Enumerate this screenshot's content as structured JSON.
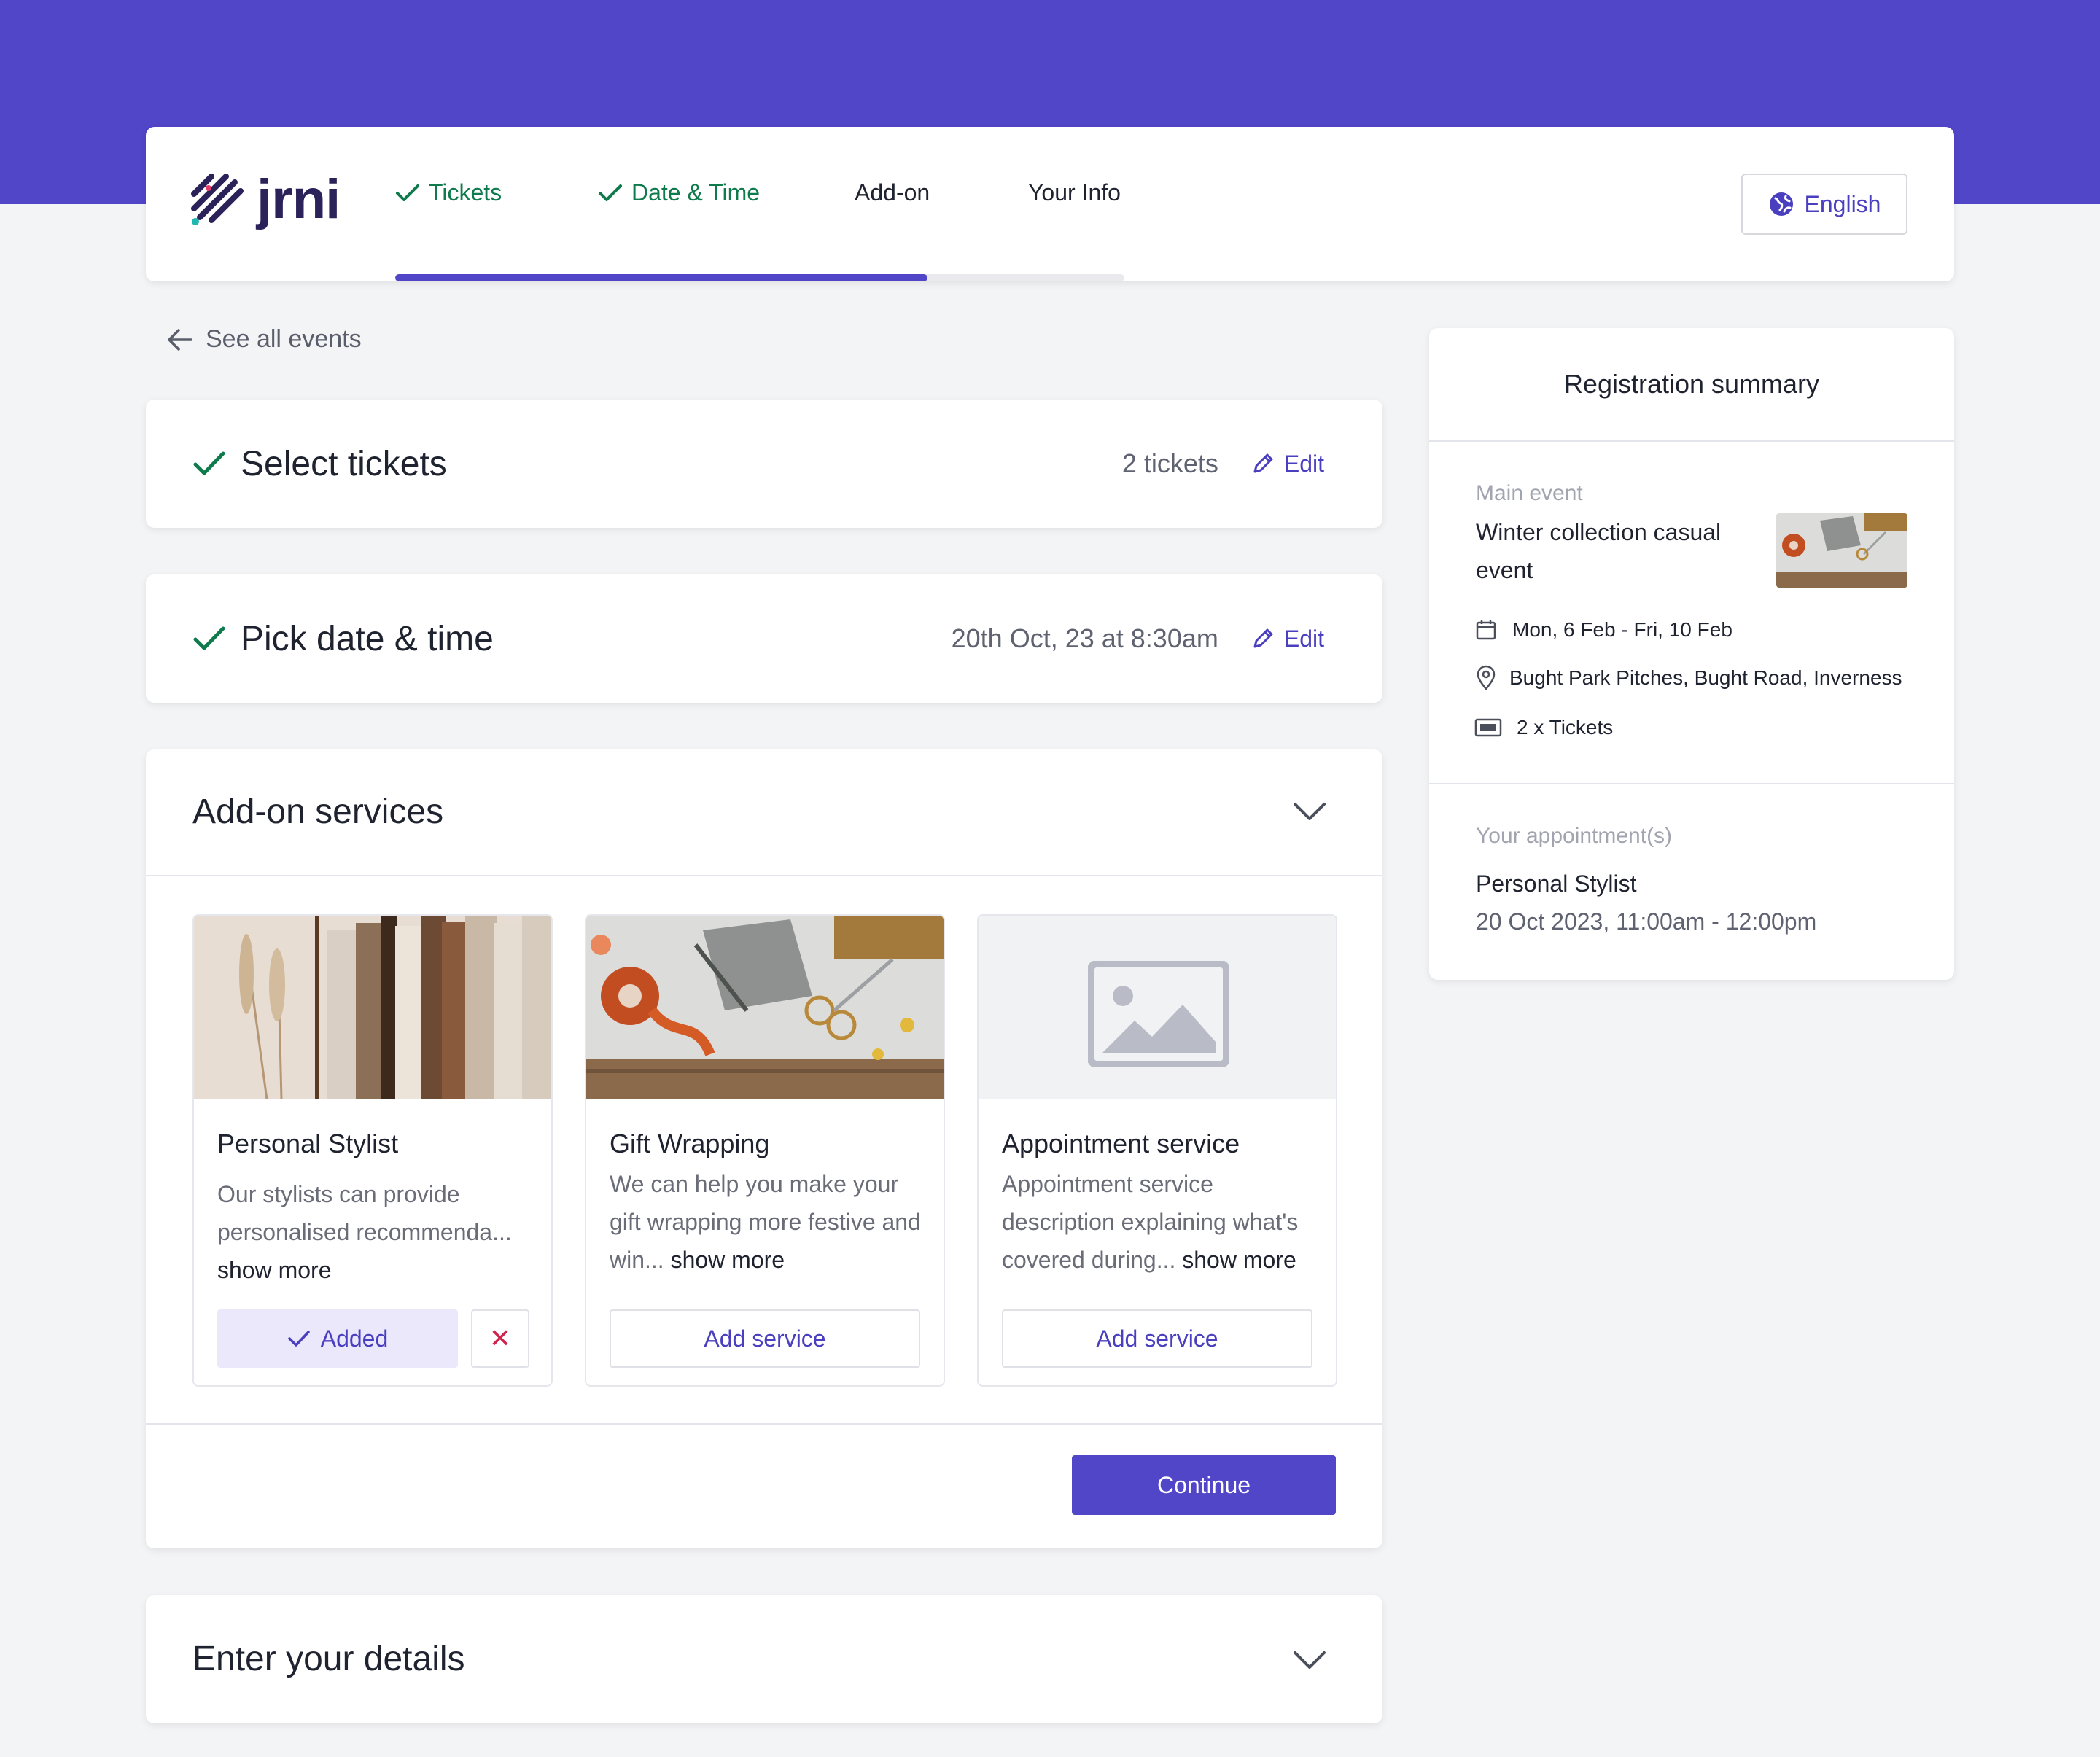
{
  "brand": {
    "name": "jrni",
    "primary": "#5145c8",
    "success": "#0f7a4c",
    "danger": "#d0234c"
  },
  "steps": [
    {
      "label": "Tickets",
      "done": true
    },
    {
      "label": "Date & Time",
      "done": true
    },
    {
      "label": "Add-on",
      "done": false
    },
    {
      "label": "Your Info",
      "done": false
    }
  ],
  "progress": {
    "fraction": 0.73
  },
  "language": {
    "label": "English",
    "icon": "globe-icon"
  },
  "back_link": {
    "label": "See all events",
    "icon": "arrow-left-icon"
  },
  "select_tickets": {
    "title": "Select tickets",
    "value": "2 tickets",
    "edit": "Edit"
  },
  "pick_date": {
    "title": "Pick date & time",
    "value": "20th Oct, 23 at 8:30am",
    "edit": "Edit"
  },
  "addons": {
    "title": "Add-on services",
    "services": [
      {
        "title": "Personal Stylist",
        "desc": "Our stylists can provide personalised recommenda...",
        "more": "show more",
        "status": "added",
        "added_label": "Added",
        "remove_label": "✕"
      },
      {
        "title": "Gift Wrapping",
        "desc": "We can help you make your gift wrapping more festive and win...",
        "more": "show more",
        "status": "available",
        "add_label": "Add service"
      },
      {
        "title": "Appointment service",
        "desc": "Appointment service description explaining what's covered during...",
        "more": "show more",
        "status": "available",
        "add_label": "Add service"
      }
    ],
    "continue_label": "Continue"
  },
  "enter_details": {
    "title": "Enter your details"
  },
  "summary": {
    "title": "Registration summary",
    "main_event_label": "Main event",
    "event_name": "Winter collection casual event",
    "dates": "Mon, 6 Feb - Fri, 10 Feb",
    "location": "Bught Park Pitches, Bught Road, Inverness",
    "tickets": "2 x Tickets",
    "appointments_label": "Your appointment(s)",
    "appointment_name": "Personal Stylist",
    "appointment_time": "20 Oct 2023, 11:00am - 12:00pm"
  }
}
